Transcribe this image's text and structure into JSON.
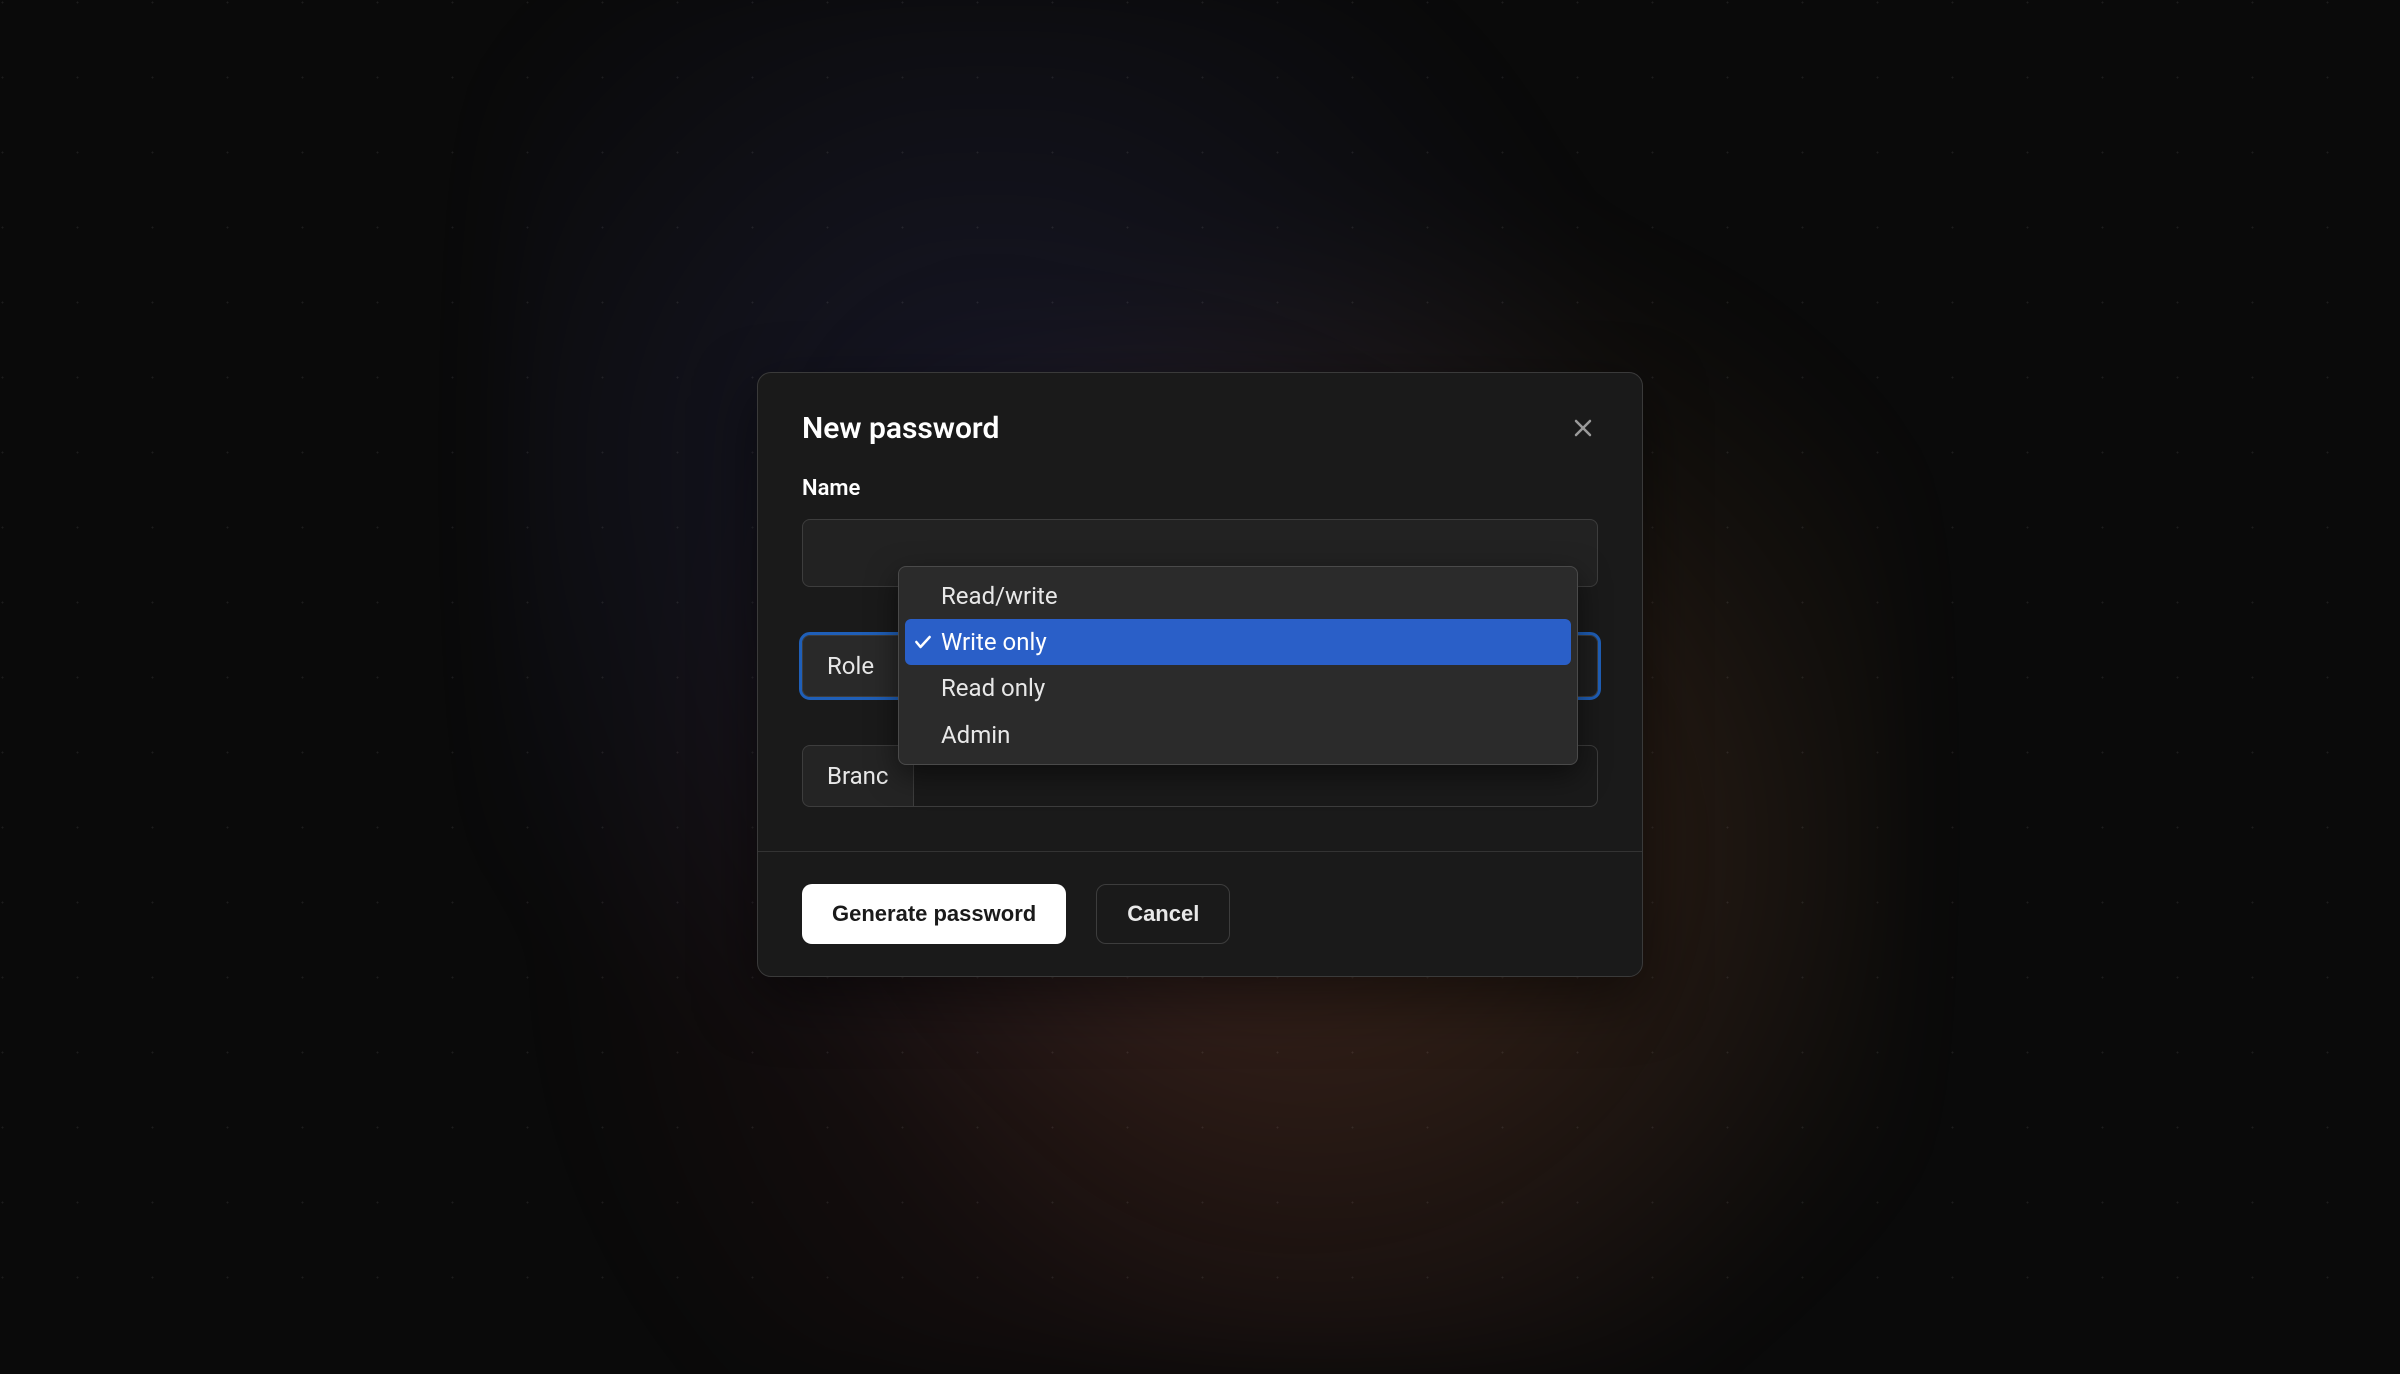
{
  "dialog": {
    "title": "New password",
    "name_label": "Name",
    "name_value": "",
    "role_label": "Role",
    "role_value": "",
    "branch_label": "Branc",
    "branch_value": ""
  },
  "dropdown": {
    "options": [
      {
        "label": "Read/write",
        "selected": false
      },
      {
        "label": "Write only",
        "selected": true
      },
      {
        "label": "Read only",
        "selected": false
      },
      {
        "label": "Admin",
        "selected": false
      }
    ]
  },
  "footer": {
    "generate_label": "Generate password",
    "cancel_label": "Cancel"
  }
}
